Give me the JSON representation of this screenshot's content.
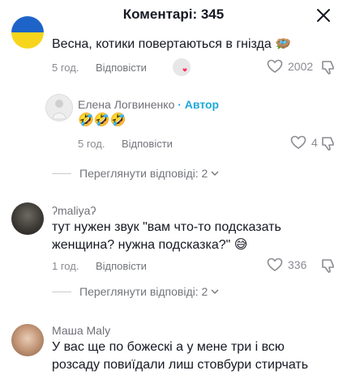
{
  "header": {
    "title": "Коментарі: 345"
  },
  "comments": [
    {
      "name": "",
      "text": "Весна, котики повертаються в гнізда",
      "time": "5 год.",
      "reply_label": "Відповісти",
      "likes": "2002",
      "emoji": "🪺"
    },
    {
      "name": "Елена Логвиненко",
      "author_badge": "· Автор",
      "text": "🤣🤣🤣",
      "time": "5 год.",
      "reply_label": "Відповісти",
      "likes": "4"
    },
    {
      "name": "ʔmaliyaʔ",
      "text_lines": [
        "тут нужен звук \"вам что-то подсказать",
        "женщина? нужна подсказка?\" 😅"
      ],
      "time": "1 год.",
      "reply_label": "Відповісти",
      "likes": "336"
    },
    {
      "name": "Маша Maly",
      "text_lines": [
        "У вас ще по божескі а у мене три і всю",
        "розсаду повиїдали лиш стовбури стирчать"
      ]
    }
  ],
  "view_replies": [
    {
      "label": "Переглянути відповіді: 2"
    },
    {
      "label": "Переглянути відповіді: 2"
    }
  ],
  "icons": [
    "close-icon",
    "heart-icon",
    "dislike-icon",
    "chevron-down-icon"
  ]
}
